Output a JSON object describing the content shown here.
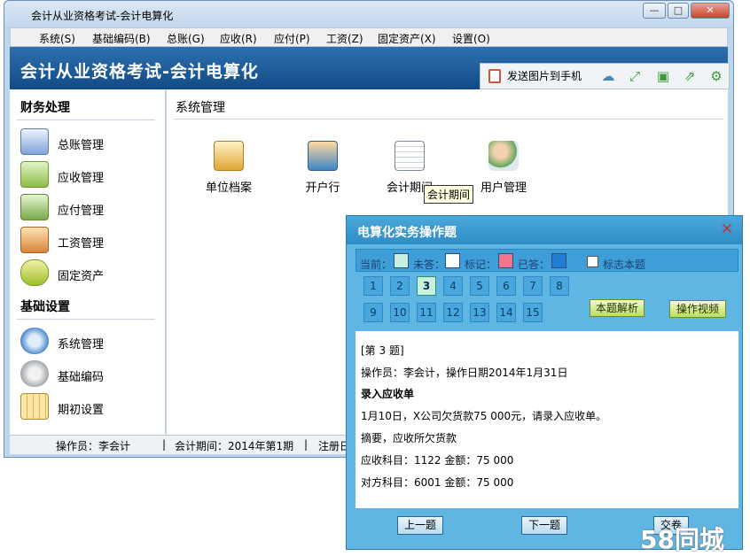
{
  "window": {
    "title": "会计从业资格考试-会计电算化",
    "min": "—",
    "max": "□",
    "close": "✕"
  },
  "menu": [
    "系统(S)",
    "基础编码(B)",
    "总账(G)",
    "应收(R)",
    "应付(P)",
    "工资(Z)",
    "固定资产(X)",
    "设置(O)"
  ],
  "header": {
    "title": "会计从业资格考试-会计电算化",
    "send_label": "发送图片到手机"
  },
  "toolbar_icons": [
    "cloud-icon",
    "expand-icon",
    "save-icon",
    "export-icon",
    "settings-icon"
  ],
  "sidebar": {
    "section1": "财务处理",
    "items1": [
      "总账管理",
      "应收管理",
      "应付管理",
      "工资管理",
      "固定资产"
    ],
    "section2": "基础设置",
    "items2": [
      "系统管理",
      "基础编码",
      "期初设置"
    ]
  },
  "content": {
    "title": "系统管理",
    "modules": [
      "单位档案",
      "开户行",
      "会计期间",
      "用户管理"
    ],
    "tooltip": "会计期间"
  },
  "status": {
    "operator": "操作员：李会计",
    "period": "会计期间：2014年第1期",
    "reg": "注册日"
  },
  "dialog": {
    "title": "电算化实务操作题",
    "close": "✕",
    "legend": {
      "current": "当前：",
      "unanswered": "未答：",
      "marked": "标记：",
      "answered": "已答：",
      "flag": "标志本题"
    },
    "swatch_colors": {
      "current": "#c7f0de",
      "unanswered": "#ffffff",
      "marked": "#f0768c",
      "answered": "#1f7ed2"
    },
    "question_numbers": [
      "1",
      "2",
      "3",
      "4",
      "5",
      "6",
      "7",
      "8",
      "9",
      "10",
      "11",
      "12",
      "13",
      "14",
      "15"
    ],
    "current_question": "3",
    "analysis_btn": "本题解析",
    "video_btn": "操作视频",
    "question": {
      "num": "[第 3 题]",
      "info": "操作员：李会计，操作日期2014年1月31日",
      "heading": "录入应收单",
      "text": "1月10日，X公司欠货款75 000元，请录入应收单。",
      "summary": "摘要，应收所欠货款",
      "debit": "应收科目：1122 金额：75 000",
      "credit": "对方科目：6001 金额：75 000"
    },
    "prev_btn": "上一题",
    "next_btn": "下一题",
    "partial_btn": "交卷"
  },
  "watermark": "58同城"
}
